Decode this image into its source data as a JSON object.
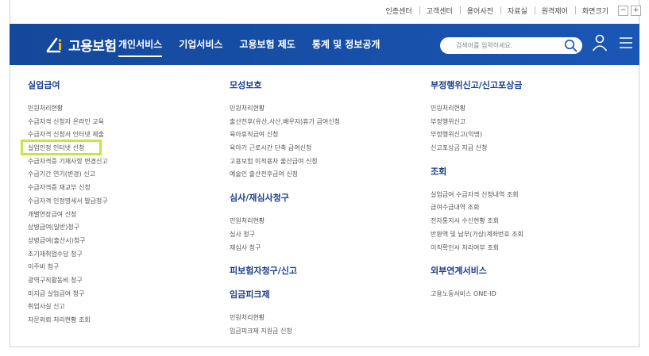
{
  "util_links": [
    "인증센터",
    "고객센터",
    "용어사전",
    "자료실",
    "원격제어",
    "화면크기"
  ],
  "zoom": {
    "minus": "−",
    "plus": "+"
  },
  "logo_text": "고용보험",
  "gnb": [
    "개인서비스",
    "기업서비스",
    "고용보험 제도",
    "통계 및 정보공개"
  ],
  "search": {
    "placeholder": "검색어를 입력하세요."
  },
  "colors": {
    "header": "#1a56b4",
    "heading": "#1c3f8f",
    "highlight": "#c3e93d"
  },
  "col1": {
    "title": "실업급여",
    "items": [
      "민원처리현황",
      "수급자격 신청자 온라인 교육",
      "수급자격 신청서 인터넷 제출",
      "실업인정 인터넷 신청",
      "수급자격증 기재사항 변경신고",
      "수급기간 연기(변경) 신고",
      "수급자격증 재교부 신청",
      "수급자격 인정명세서 발급청구",
      "개별연장급여 신청",
      "상병급여(일반)청구",
      "상병급여(출산시)청구",
      "조기재취업수당 청구",
      "이주비 청구",
      "광역구직활동비 청구",
      "미지급 실업급여 청구",
      "취업사실 신고",
      "자문외뢰 처리현황 조회"
    ]
  },
  "col2": {
    "title": "모성보호",
    "items": [
      "민원처리현황",
      "출산전후(유산,사산,배우자)휴가 급여신청",
      "육아휴직급여 신청",
      "육아기 근로시간 단축 급여신청",
      "고용보험 미적용자 출산급여 신청",
      "예술인 출산전후급여 신청"
    ],
    "sections": [
      {
        "title": "심사/재심사청구",
        "items": [
          "민원처리현황",
          "심사 청구",
          "재심사 청구"
        ]
      },
      {
        "title": "피보험자청구/신고",
        "items": []
      },
      {
        "title": "임금피크제",
        "items": [
          "민원처리현황",
          "임금피크제 지원금 신청"
        ]
      }
    ]
  },
  "col3": {
    "title": "부정행위신고/신고포상금",
    "items": [
      "민원처리현황",
      "부정행위신고",
      "부정행위신고(익명)",
      "신고포상금 지급 신청"
    ],
    "sections": [
      {
        "title": "조회",
        "items": [
          "실업급여 수급자격 신청내역 조회",
          "급여수급내역 조회",
          "전자통지서 수신현황 조회",
          "반환액 및 납부(가상)계좌번호 조회",
          "이직확인서 처리여부 조회"
        ]
      },
      {
        "title": "외부연계서비스",
        "items": [
          "고용노동서비스 ONE-ID"
        ]
      }
    ]
  }
}
